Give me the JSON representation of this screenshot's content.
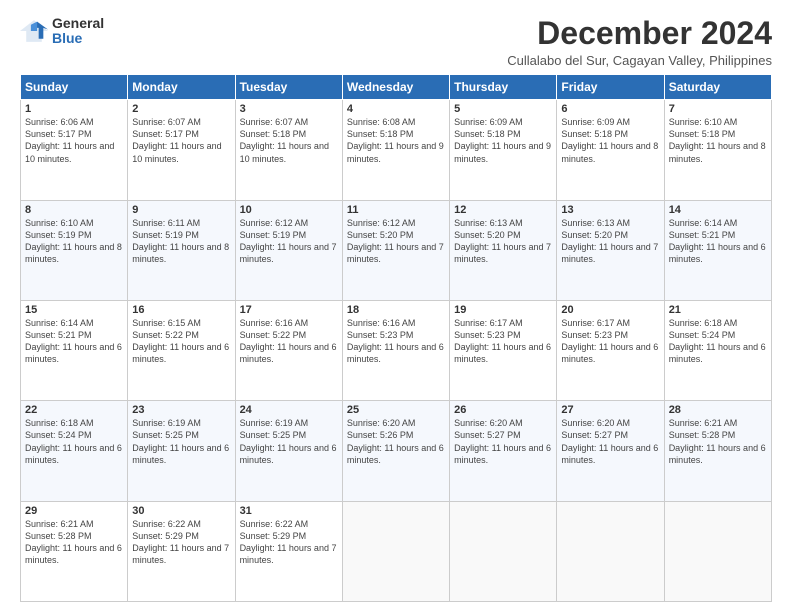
{
  "logo": {
    "general": "General",
    "blue": "Blue"
  },
  "title": "December 2024",
  "subtitle": "Cullalabo del Sur, Cagayan Valley, Philippines",
  "headers": [
    "Sunday",
    "Monday",
    "Tuesday",
    "Wednesday",
    "Thursday",
    "Friday",
    "Saturday"
  ],
  "weeks": [
    [
      {
        "day": "1",
        "sunrise": "6:06 AM",
        "sunset": "5:17 PM",
        "daylight": "11 hours and 10 minutes."
      },
      {
        "day": "2",
        "sunrise": "6:07 AM",
        "sunset": "5:17 PM",
        "daylight": "11 hours and 10 minutes."
      },
      {
        "day": "3",
        "sunrise": "6:07 AM",
        "sunset": "5:18 PM",
        "daylight": "11 hours and 10 minutes."
      },
      {
        "day": "4",
        "sunrise": "6:08 AM",
        "sunset": "5:18 PM",
        "daylight": "11 hours and 9 minutes."
      },
      {
        "day": "5",
        "sunrise": "6:09 AM",
        "sunset": "5:18 PM",
        "daylight": "11 hours and 9 minutes."
      },
      {
        "day": "6",
        "sunrise": "6:09 AM",
        "sunset": "5:18 PM",
        "daylight": "11 hours and 8 minutes."
      },
      {
        "day": "7",
        "sunrise": "6:10 AM",
        "sunset": "5:18 PM",
        "daylight": "11 hours and 8 minutes."
      }
    ],
    [
      {
        "day": "8",
        "sunrise": "6:10 AM",
        "sunset": "5:19 PM",
        "daylight": "11 hours and 8 minutes."
      },
      {
        "day": "9",
        "sunrise": "6:11 AM",
        "sunset": "5:19 PM",
        "daylight": "11 hours and 8 minutes."
      },
      {
        "day": "10",
        "sunrise": "6:12 AM",
        "sunset": "5:19 PM",
        "daylight": "11 hours and 7 minutes."
      },
      {
        "day": "11",
        "sunrise": "6:12 AM",
        "sunset": "5:20 PM",
        "daylight": "11 hours and 7 minutes."
      },
      {
        "day": "12",
        "sunrise": "6:13 AM",
        "sunset": "5:20 PM",
        "daylight": "11 hours and 7 minutes."
      },
      {
        "day": "13",
        "sunrise": "6:13 AM",
        "sunset": "5:20 PM",
        "daylight": "11 hours and 7 minutes."
      },
      {
        "day": "14",
        "sunrise": "6:14 AM",
        "sunset": "5:21 PM",
        "daylight": "11 hours and 6 minutes."
      }
    ],
    [
      {
        "day": "15",
        "sunrise": "6:14 AM",
        "sunset": "5:21 PM",
        "daylight": "11 hours and 6 minutes."
      },
      {
        "day": "16",
        "sunrise": "6:15 AM",
        "sunset": "5:22 PM",
        "daylight": "11 hours and 6 minutes."
      },
      {
        "day": "17",
        "sunrise": "6:16 AM",
        "sunset": "5:22 PM",
        "daylight": "11 hours and 6 minutes."
      },
      {
        "day": "18",
        "sunrise": "6:16 AM",
        "sunset": "5:23 PM",
        "daylight": "11 hours and 6 minutes."
      },
      {
        "day": "19",
        "sunrise": "6:17 AM",
        "sunset": "5:23 PM",
        "daylight": "11 hours and 6 minutes."
      },
      {
        "day": "20",
        "sunrise": "6:17 AM",
        "sunset": "5:23 PM",
        "daylight": "11 hours and 6 minutes."
      },
      {
        "day": "21",
        "sunrise": "6:18 AM",
        "sunset": "5:24 PM",
        "daylight": "11 hours and 6 minutes."
      }
    ],
    [
      {
        "day": "22",
        "sunrise": "6:18 AM",
        "sunset": "5:24 PM",
        "daylight": "11 hours and 6 minutes."
      },
      {
        "day": "23",
        "sunrise": "6:19 AM",
        "sunset": "5:25 PM",
        "daylight": "11 hours and 6 minutes."
      },
      {
        "day": "24",
        "sunrise": "6:19 AM",
        "sunset": "5:25 PM",
        "daylight": "11 hours and 6 minutes."
      },
      {
        "day": "25",
        "sunrise": "6:20 AM",
        "sunset": "5:26 PM",
        "daylight": "11 hours and 6 minutes."
      },
      {
        "day": "26",
        "sunrise": "6:20 AM",
        "sunset": "5:27 PM",
        "daylight": "11 hours and 6 minutes."
      },
      {
        "day": "27",
        "sunrise": "6:20 AM",
        "sunset": "5:27 PM",
        "daylight": "11 hours and 6 minutes."
      },
      {
        "day": "28",
        "sunrise": "6:21 AM",
        "sunset": "5:28 PM",
        "daylight": "11 hours and 6 minutes."
      }
    ],
    [
      {
        "day": "29",
        "sunrise": "6:21 AM",
        "sunset": "5:28 PM",
        "daylight": "11 hours and 6 minutes."
      },
      {
        "day": "30",
        "sunrise": "6:22 AM",
        "sunset": "5:29 PM",
        "daylight": "11 hours and 7 minutes."
      },
      {
        "day": "31",
        "sunrise": "6:22 AM",
        "sunset": "5:29 PM",
        "daylight": "11 hours and 7 minutes."
      },
      null,
      null,
      null,
      null
    ]
  ],
  "labels": {
    "sunrise": "Sunrise:",
    "sunset": "Sunset:",
    "daylight": "Daylight:"
  }
}
